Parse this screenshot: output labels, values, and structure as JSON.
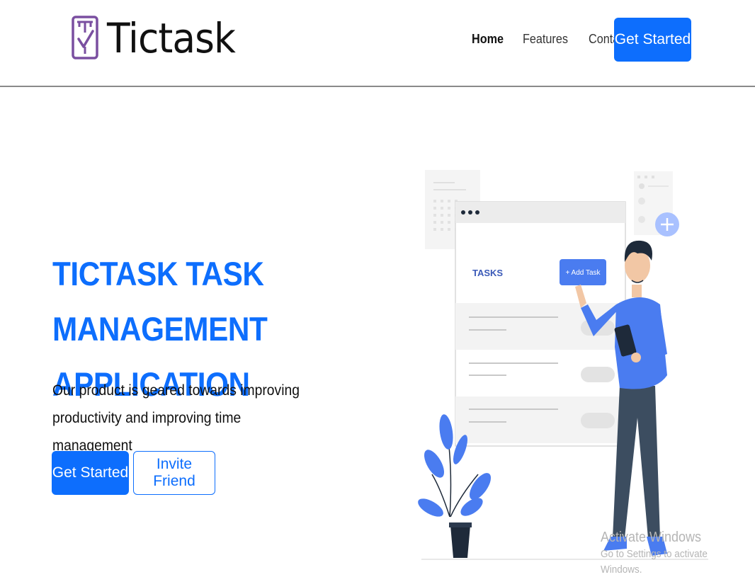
{
  "brand": {
    "name": "Tictask",
    "accent": "#0d6efd",
    "logo_color": "#7a4fa0"
  },
  "nav": {
    "items": [
      {
        "label": "Home",
        "active": true
      },
      {
        "label": "Features",
        "active": false
      },
      {
        "label": "Contact",
        "active": false
      }
    ],
    "cta_label": "Get Started"
  },
  "hero": {
    "title_line1": "TICTASK TASK MANAGEMENT",
    "title_line2": "APPLICATION",
    "subtitle_line1": "Our product is geared towards improving",
    "subtitle_line2": "productivity and improving time management",
    "primary_button": "Get Started",
    "secondary_button": "Invite Friend"
  },
  "illustration": {
    "panel_heading": "TASKS",
    "add_button": "+ Add Task"
  },
  "watermark": {
    "title": "Activate Windows",
    "subtitle": "Go to Settings to activate Windows."
  }
}
